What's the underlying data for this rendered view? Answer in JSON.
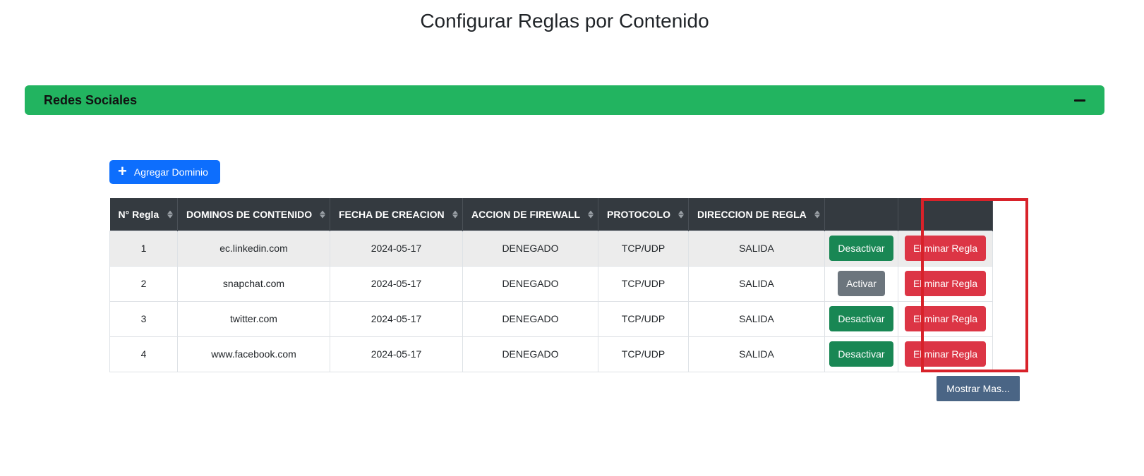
{
  "page": {
    "title": "Configurar Reglas por Contenido"
  },
  "category": {
    "title": "Redes Sociales",
    "collapse_icon": "minus-icon"
  },
  "toolbar": {
    "add_label": "Agregar Dominio",
    "add_icon": "plus-icon"
  },
  "table": {
    "columns": [
      "N° Regla",
      "DOMINOS DE CONTENIDO",
      "FECHA DE CREACION",
      "ACCION DE FIREWALL",
      "PROTOCOLO",
      "DIRECCION DE REGLA",
      "",
      ""
    ],
    "rows": [
      {
        "num": "1",
        "domain": "ec.linkedin.com",
        "date": "2024-05-17",
        "action": "DENEGADO",
        "protocol": "TCP/UDP",
        "direction": "SALIDA",
        "toggle_label": "Desactivar",
        "toggle_state": "active",
        "delete_label": "Eliminar Regla"
      },
      {
        "num": "2",
        "domain": "snapchat.com",
        "date": "2024-05-17",
        "action": "DENEGADO",
        "protocol": "TCP/UDP",
        "direction": "SALIDA",
        "toggle_label": "Activar",
        "toggle_state": "inactive",
        "delete_label": "Eliminar Regla"
      },
      {
        "num": "3",
        "domain": "twitter.com",
        "date": "2024-05-17",
        "action": "DENEGADO",
        "protocol": "TCP/UDP",
        "direction": "SALIDA",
        "toggle_label": "Desactivar",
        "toggle_state": "active",
        "delete_label": "Eliminar Regla"
      },
      {
        "num": "4",
        "domain": "www.facebook.com",
        "date": "2024-05-17",
        "action": "DENEGADO",
        "protocol": "TCP/UDP",
        "direction": "SALIDA",
        "toggle_label": "Desactivar",
        "toggle_state": "active",
        "delete_label": "Eliminar Regla"
      }
    ]
  },
  "pagination": {
    "more_label": "Mostrar Mas..."
  },
  "colors": {
    "category_bar": "#22b460",
    "primary": "#0d6efd",
    "success": "#198754",
    "secondary": "#6c757d",
    "danger": "#dc3545",
    "header_dark": "#343a40",
    "highlight": "#d8222a"
  }
}
